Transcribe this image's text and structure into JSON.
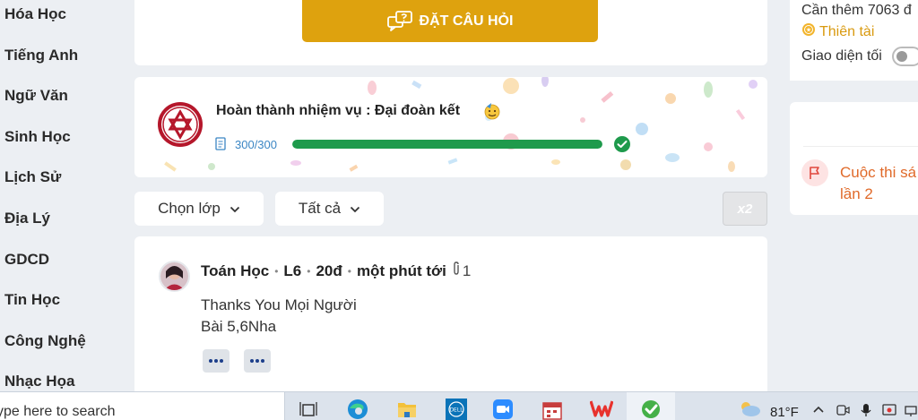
{
  "sidebar": {
    "items": [
      {
        "label": "Hóa Học"
      },
      {
        "label": "Tiếng Anh"
      },
      {
        "label": "Ngữ Văn"
      },
      {
        "label": "Sinh Học"
      },
      {
        "label": "Lịch Sử"
      },
      {
        "label": "Địa Lý"
      },
      {
        "label": "GDCD"
      },
      {
        "label": "Tin Học"
      },
      {
        "label": "Công Nghệ"
      },
      {
        "label": "Nhạc Họa"
      }
    ]
  },
  "ask": {
    "button_label": "ĐẶT CÂU HỎI",
    "icon": "question-chat-icon",
    "color": "#dea20e"
  },
  "mission": {
    "title": "Hoàn thành nhiệm vụ : Đại đoàn kết",
    "progress_text": "300/300",
    "progress_fraction": 1.0,
    "progress_color": "#1e9a4c",
    "badge_icon": "star-of-david-badge-icon",
    "complete_icon": "check-circle-icon"
  },
  "filters": {
    "class_label": "Chọn lớp",
    "all_label": "Tất cả",
    "x2_label": "x2"
  },
  "post": {
    "subject": "Toán Học",
    "grade": "L6",
    "points": "20đ",
    "time": "một phút tới",
    "attachment_count": "1",
    "line1": "Thanks You Mọi Người",
    "line2": "Bài 5,6Nha"
  },
  "right_panel": {
    "need_more": "Cần thêm 7063 đ",
    "rank": "Thiên tài",
    "dark_mode_label": "Giao diện tối",
    "dark_mode_on": false,
    "contest_line1": "Cuộc thi sá",
    "contest_line2": "lần 2"
  },
  "taskbar": {
    "search_placeholder": "ype here to search",
    "temperature": "81°F",
    "apps": [
      "task-view-icon",
      "edge-icon",
      "file-explorer-icon",
      "dell-icon",
      "zoom-icon",
      "calendar-app-icon",
      "wps-office-icon",
      "green-app-icon"
    ]
  }
}
